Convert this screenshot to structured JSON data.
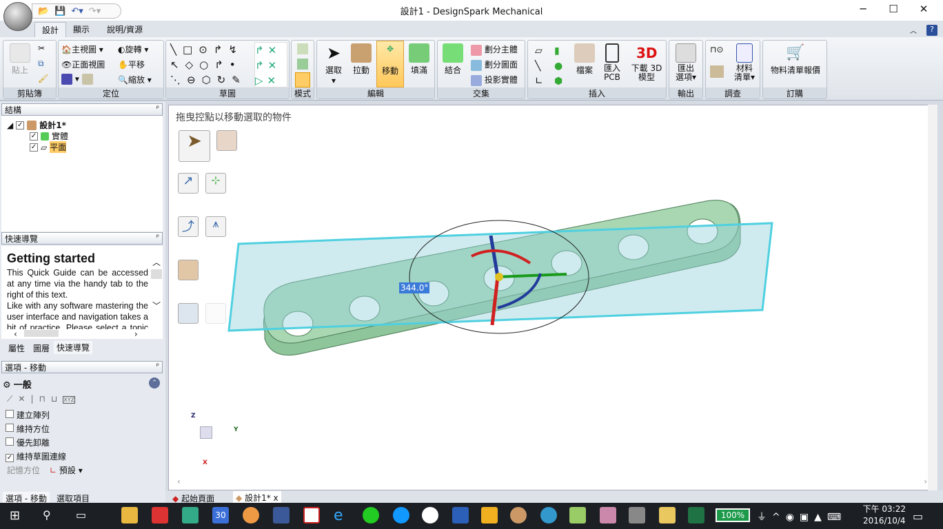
{
  "window": {
    "title": "設計1 - DesignSpark Mechanical",
    "minimize": "─",
    "maximize": "☐",
    "close": "✕"
  },
  "ribbon_tabs": [
    "設計",
    "顯示",
    "說明/資源"
  ],
  "ribbon": {
    "clipboard": {
      "label": "剪貼簿",
      "paste": "貼上"
    },
    "orient": {
      "label": "定位",
      "home": "主視圖",
      "front": "正面視圖",
      "spin": "旋轉",
      "pan": "平移",
      "zoom": "縮放"
    },
    "sketch": {
      "label": "草圖"
    },
    "mode": {
      "label": "模式"
    },
    "edit": {
      "label": "編輯",
      "select": "選取",
      "pull": "拉動",
      "move": "移動",
      "fill": "填滿"
    },
    "intersect": {
      "label": "交集",
      "combine": "結合",
      "split_body": "劃分主體",
      "split_face": "劃分圖面",
      "project": "投影實體"
    },
    "insert": {
      "label": "插入",
      "file": "檔案",
      "pcb": "匯入\nPCB",
      "download3d": "下載 3D\n模型",
      "logo3d": "3D"
    },
    "output": {
      "label": "輸出",
      "export": "匯出\n選項▾"
    },
    "investigate": {
      "label": "調查",
      "bom": "材料\n清單▾"
    },
    "order": {
      "label": "訂購",
      "bom_quote": "物料清單報價"
    }
  },
  "structure": {
    "title": "結構",
    "root": "設計1*",
    "items": [
      "實體",
      "平面"
    ]
  },
  "quick_guide": {
    "title": "快速導覽",
    "heading": "Getting started",
    "p1": "This Quick Guide can be accessed at any time via the handy tab to the right of this text.",
    "p2": "Like with any software mastering the user interface and navigation takes a bit of practice. Please select a topic of"
  },
  "panel_tabs": [
    "屬性",
    "圖層",
    "快速導覽"
  ],
  "options": {
    "title": "選項 - 移動",
    "section": "一般",
    "checkboxes": [
      {
        "label": "建立陣列",
        "checked": false
      },
      {
        "label": "維持方位",
        "checked": false
      },
      {
        "label": "優先卸離",
        "checked": false
      },
      {
        "label": "維持草圖連線",
        "checked": true
      }
    ],
    "remember_label": "記憶方位",
    "remember_value": "預設"
  },
  "bottom_tabs": [
    "選項 - 移動",
    "選取項目"
  ],
  "viewport": {
    "hint": "拖曳控點以移動選取的物件",
    "angle": "344.0°",
    "axes": {
      "x": "X",
      "y": "Y",
      "z": "Z"
    }
  },
  "doc_tabs": [
    {
      "label": "起始頁面"
    },
    {
      "label": "設計1*",
      "close": "x"
    }
  ],
  "taskbar": {
    "battery": "100%",
    "time": "下午 03:22",
    "date": "2016/10/4",
    "calendar_day": "30"
  }
}
